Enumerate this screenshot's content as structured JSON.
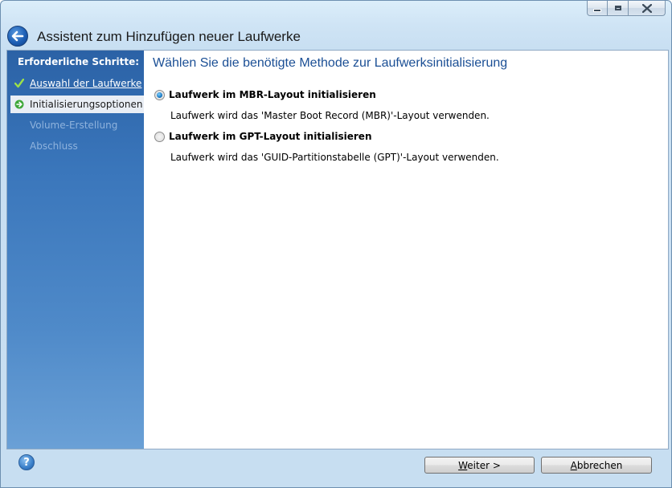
{
  "window": {
    "title": "Assistent zum Hinzufügen neuer Laufwerke",
    "controls": [
      "minimize-icon",
      "maximize-icon",
      "close-icon"
    ]
  },
  "sidebar": {
    "heading": "Erforderliche Schritte:",
    "items": [
      {
        "label": "Auswahl der Laufwerke",
        "state": "done",
        "icon": "checkmark-icon"
      },
      {
        "label": "Initialisierungsoptionen",
        "state": "active",
        "icon": "arrow-right-icon"
      },
      {
        "label": "Volume-Erstellung",
        "state": "pending"
      },
      {
        "label": "Abschluss",
        "state": "pending"
      }
    ]
  },
  "main": {
    "heading": "Wählen Sie die benötigte Methode zur Laufwerksinitialisierung",
    "options": [
      {
        "label": "Laufwerk im MBR-Layout initialisieren",
        "description": "Laufwerk wird das 'Master Boot Record (MBR)'-Layout verwenden.",
        "selected": true
      },
      {
        "label": "Laufwerk im GPT-Layout initialisieren",
        "description": "Laufwerk wird das 'GUID-Partitionstabelle (GPT)'-Layout verwenden.",
        "selected": false
      }
    ]
  },
  "footer": {
    "help_label": "?",
    "next_label": "Weiter >",
    "cancel_label": "Abbrechen"
  },
  "colors": {
    "accent": "#1b4f95",
    "sidebar_top": "#2b62a6",
    "sidebar_bottom": "#6aa0d6",
    "frame": "#c8dff2"
  }
}
